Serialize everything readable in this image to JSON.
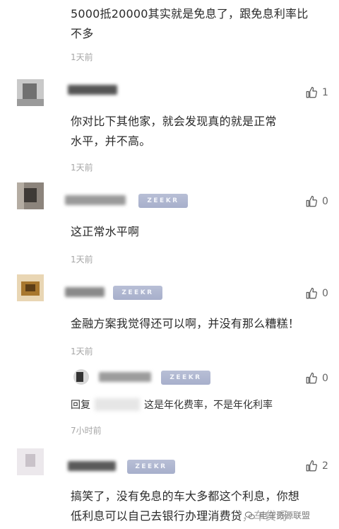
{
  "comments": [
    {
      "text_lines": [
        "5000抵20000其实就是免息了，跟免息利率比",
        "不多"
      ],
      "time": "1天前"
    },
    {
      "likes": "1",
      "text_lines": [
        "你对比下其他家，就会发现真的就是正常",
        "水平，并不高。"
      ],
      "time": "1天前"
    },
    {
      "badge": "ZEEKR",
      "likes": "0",
      "text_lines": [
        "这正常水平啊"
      ],
      "time": "1天前"
    },
    {
      "badge": "ZEEKR",
      "likes": "0",
      "text_lines": [
        "金融方案我觉得还可以啊，并没有那么糟糕！"
      ],
      "time": "1天前"
    },
    {
      "badge": "ZEEKR",
      "likes": "0",
      "reply_prefix": "回复",
      "reply_text": "这是年化费率，不是年化利率",
      "time": "7小时前"
    },
    {
      "badge": "ZEEKR",
      "likes": "2",
      "text_lines": [
        "搞笑了，没有免息的车大多都这个利息，你想",
        "低利息可以自己去银行办理消费贷，车贷呀"
      ]
    }
  ],
  "watermark": "电车资源联盟",
  "icons": {
    "like": "thumbs-up-icon",
    "watermark": "wechat-icon"
  }
}
